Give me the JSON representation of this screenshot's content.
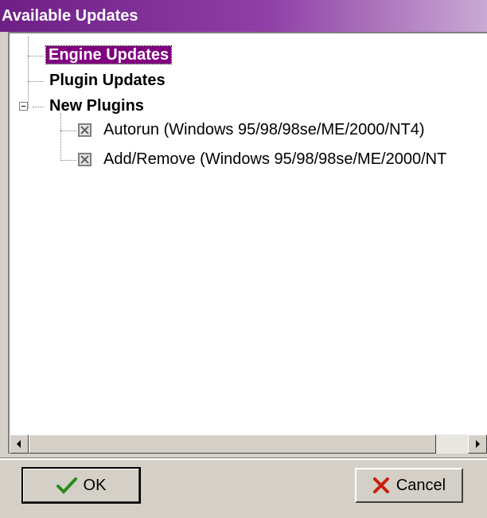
{
  "window": {
    "title": "Available Updates"
  },
  "tree": {
    "engine_updates": "Engine Updates",
    "plugin_updates": "Plugin Updates",
    "new_plugins": "New Plugins",
    "autorun": "Autorun (Windows 95/98/98se/ME/2000/NT4)",
    "add_remove": "Add/Remove (Windows 95/98/98se/ME/2000/NT"
  },
  "buttons": {
    "ok": "OK",
    "cancel": "Cancel"
  },
  "colors": {
    "selection": "#800080",
    "title_bar": "#6e1f86",
    "ok_check": "#2a8a1a",
    "cancel_x": "#c81e0e"
  }
}
